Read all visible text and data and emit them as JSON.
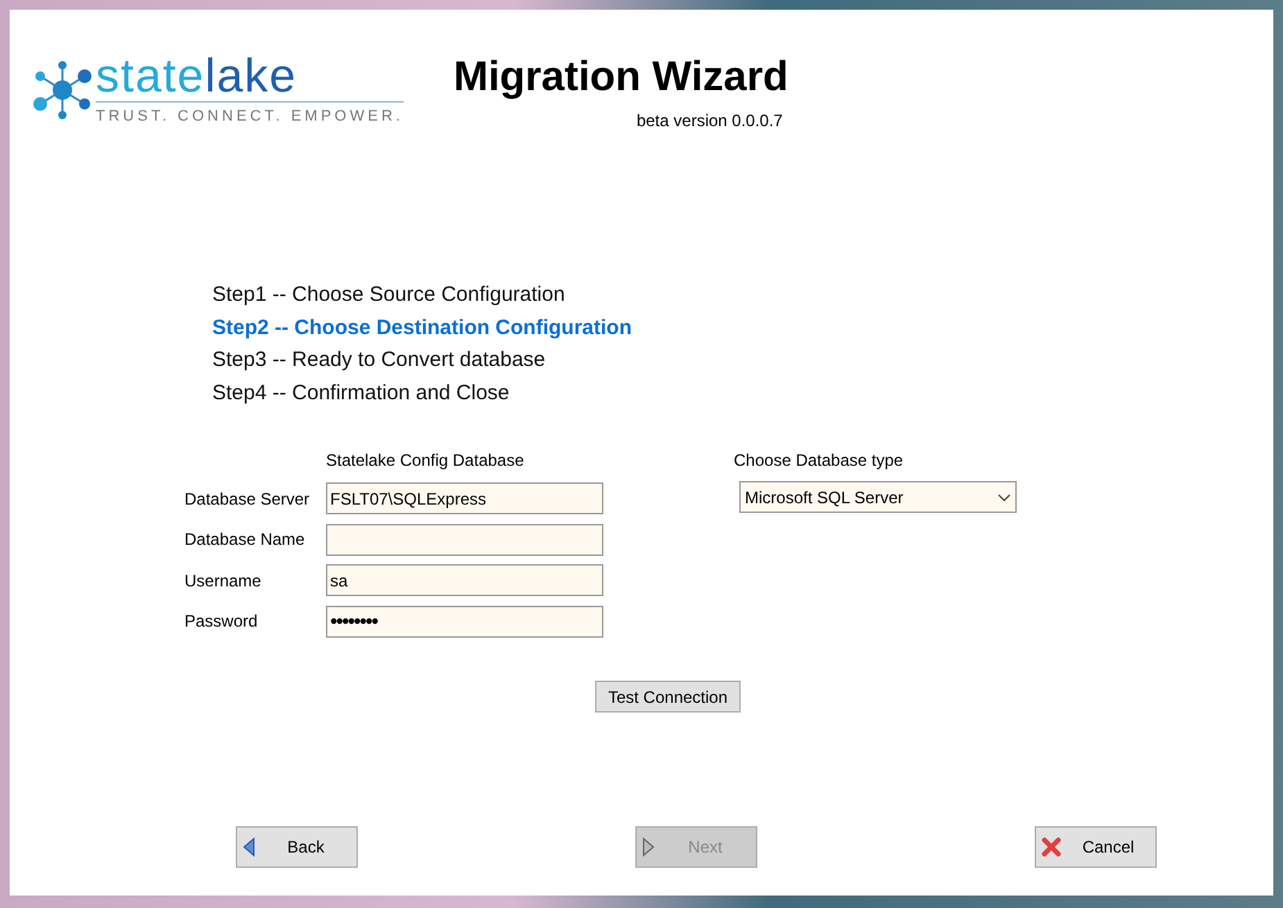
{
  "logo": {
    "word_1": "state",
    "word_2": "lake",
    "tagline": "TRUST. CONNECT. EMPOWER."
  },
  "title": "Migration Wizard",
  "version": "beta version 0.0.0.7",
  "steps": [
    {
      "label": "Step1 -- Choose Source Configuration",
      "selected": false
    },
    {
      "label": "Step2 -- Choose Destination Configuration",
      "selected": true
    },
    {
      "label": "Step3 -- Ready to Convert database",
      "selected": false
    },
    {
      "label": "Step4 -- Confirmation and Close",
      "selected": false
    }
  ],
  "config_heading": "Statelake Config Database",
  "fields": [
    {
      "label": "Database Server",
      "value": "FSLT07\\SQLExpress",
      "kind": "text"
    },
    {
      "label": "Database Name",
      "kind": "text"
    },
    {
      "label": "Username",
      "value": "sa",
      "kind": "text"
    },
    {
      "label": "Password",
      "value": "••••••••",
      "kind": "password"
    }
  ],
  "db_type": {
    "label": "Choose Database type",
    "value": "Microsoft SQL Server"
  },
  "test_button": "Test Connection",
  "nav_buttons": [
    {
      "label": "Back",
      "kind": "back",
      "disabled": false
    },
    {
      "label": "Next",
      "kind": "next",
      "disabled": true
    },
    {
      "label": "Cancel",
      "kind": "cancel",
      "disabled": false
    }
  ]
}
